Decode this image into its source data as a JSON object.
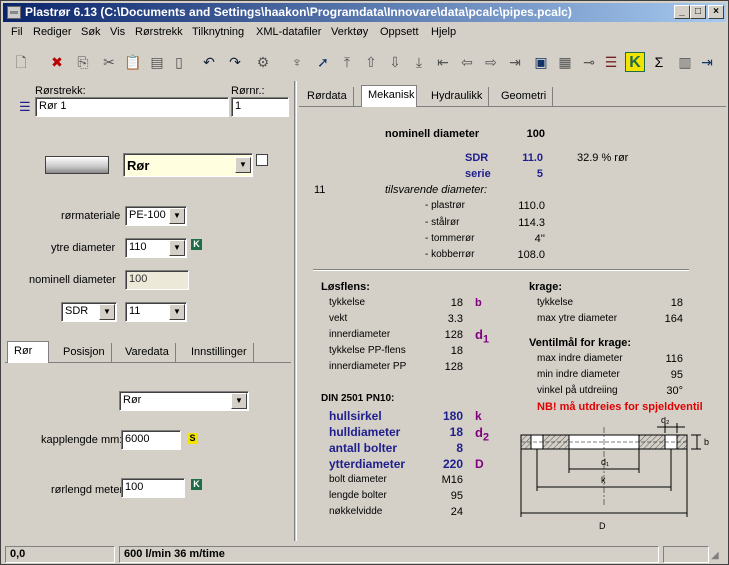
{
  "window": {
    "title": "Plastrør 6.13  (C:\\Documents and Settings\\haakon\\Programdata\\Innovare\\data\\pcalc\\pipes.pcalc)"
  },
  "menu": [
    "Fil",
    "Rediger",
    "Søk",
    "Vis",
    "Rørstrekk",
    "Tilknytning",
    "XML-datafiler",
    "Verktøy",
    "Oppsett",
    "Hjelp"
  ],
  "toolbar_icons": [
    "new-icon",
    "delete-icon",
    "copy-icon",
    "cut-icon",
    "paste-icon",
    "clipboard-icon",
    "blank-icon",
    "undo-icon",
    "redo-icon",
    "settings-icon",
    "broom-icon",
    "pointer-icon",
    "arrow-top-icon",
    "arrow-up-icon",
    "arrow-down-icon",
    "arrow-bottom-icon",
    "arrow-first-icon",
    "arrow-left-icon",
    "arrow-right-icon",
    "arrow-last-icon",
    "import-icon",
    "export-icon",
    "pipe-icon",
    "list-icon",
    "k-icon",
    "sum-icon",
    "calculator-icon",
    "exit-icon"
  ],
  "left": {
    "rorstrekk_label": "Rørstrekk:",
    "rorstrekk_value": "Rør 1",
    "rornr_label": "Rørnr.:",
    "rornr_value": "1",
    "type_value": "Rør",
    "rormateriale_label": "rørmateriale",
    "rormateriale_value": "PE-100",
    "ytre_label": "ytre diameter",
    "ytre_value": "110",
    "nominell_label": "nominell diameter",
    "nominell_value": "100",
    "sdr_value": "SDR",
    "sdr_num_value": "11",
    "tabs": [
      "Rør",
      "Posisjon",
      "Varedata",
      "Innstillinger"
    ],
    "sub_type_value": "Rør",
    "kapplengde_label": "kapplengde mm:",
    "kapplengde_value": "6000",
    "rorlengd_label": "rørlengd meter:",
    "rorlengd_value": "100",
    "k_badge": "K",
    "s_badge": "S"
  },
  "right": {
    "tabs": [
      "Rørdata",
      "Mekanisk",
      "Hydraulikk",
      "Geometri"
    ],
    "nom_label": "nominell diameter",
    "nom_value": "100",
    "sdr_label": "SDR",
    "sdr_value": "11.0",
    "percent": "32.9 % rør",
    "serie_label": "serie",
    "serie_value": "5",
    "side_num": "11",
    "tils_label": "tilsvarende diameter:",
    "equiv": [
      {
        "label": "- plastrør",
        "value": "110.0"
      },
      {
        "label": "- stålrør",
        "value": "114.3"
      },
      {
        "label": "- tommerør",
        "value": "4''"
      },
      {
        "label": "- kobberrør",
        "value": "108.0"
      }
    ],
    "losflens_title": "Løsflens:",
    "losflens": [
      {
        "label": "tykkelse",
        "value": "18",
        "sym": "b"
      },
      {
        "label": "vekt",
        "value": "3.3",
        "sym": ""
      },
      {
        "label": "innerdiameter",
        "value": "128",
        "sym": "d1"
      },
      {
        "label": "tykkelse PP-flens",
        "value": "18",
        "sym": ""
      },
      {
        "label": "innerdiameter PP",
        "value": "128",
        "sym": ""
      }
    ],
    "krage_title": "krage:",
    "krage": [
      {
        "label": "tykkelse",
        "value": "18"
      },
      {
        "label": "max ytre diameter",
        "value": "164"
      }
    ],
    "ventil_title": "Ventilmål for krage:",
    "ventil": [
      {
        "label": "max indre diameter",
        "value": "116"
      },
      {
        "label": "min indre diameter",
        "value": "95"
      },
      {
        "label": "vinkel på utdreiing",
        "value": "30°"
      }
    ],
    "warning": "NB! må utdreies for spjeldventil",
    "din_title": "DIN 2501 PN10:",
    "din_bold": [
      {
        "label": "hullsirkel",
        "value": "180",
        "sym": "k"
      },
      {
        "label": "hulldiameter",
        "value": "18",
        "sym": "d2"
      },
      {
        "label": "antall bolter",
        "value": "8",
        "sym": ""
      },
      {
        "label": "ytterdiameter",
        "value": "220",
        "sym": "D"
      }
    ],
    "din_plain": [
      {
        "label": "bolt diameter",
        "value": "M16"
      },
      {
        "label": "lengde bolter",
        "value": "95"
      },
      {
        "label": "nøkkelvidde",
        "value": "24"
      }
    ],
    "diagram_labels": {
      "d2": "d₂",
      "b": "b",
      "d1": "d₁",
      "k": "k",
      "D": "D"
    }
  },
  "status": {
    "coords": "0,0",
    "flow": "600 l/min   36 m/time"
  }
}
